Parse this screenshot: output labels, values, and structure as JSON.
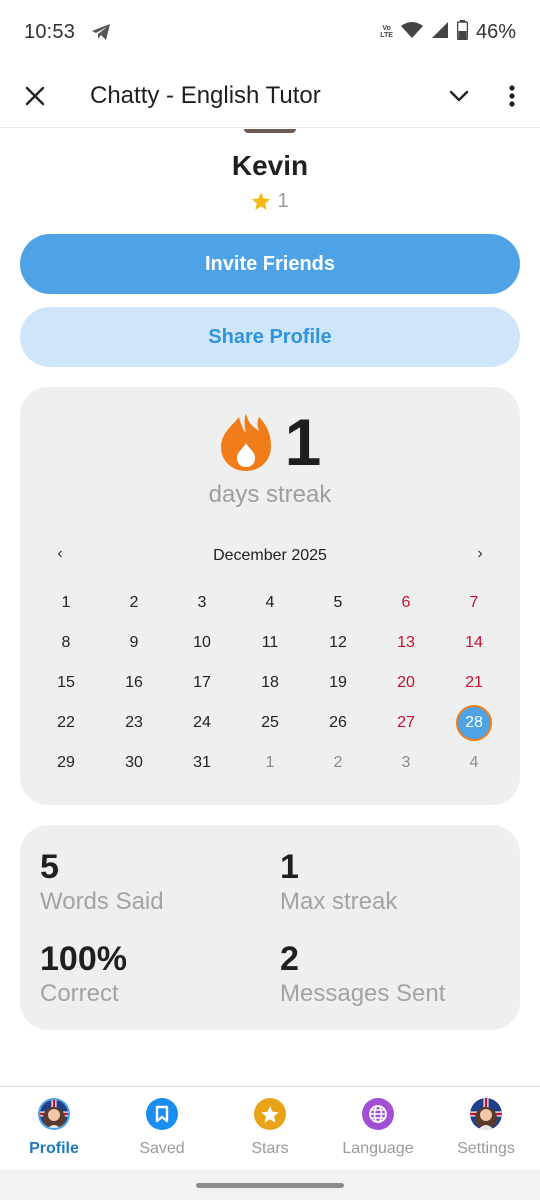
{
  "status_bar": {
    "time": "10:53",
    "volte_line1": "Vo",
    "volte_line2": "LTE",
    "battery": "46%",
    "icons": [
      "telegram-icon",
      "volte-icon",
      "wifi-icon",
      "signal-icon",
      "battery-icon"
    ]
  },
  "app_bar": {
    "title": "Chatty - English Tutor",
    "icons": [
      "close-icon",
      "chevron-down-icon",
      "more-vert-icon"
    ]
  },
  "profile": {
    "name": "Kevin",
    "stars": "1"
  },
  "buttons": {
    "invite": "Invite Friends",
    "share": "Share Profile"
  },
  "streak": {
    "count": "1",
    "label": "days streak",
    "icon": "flame-icon",
    "accent_color": "#f07d1a"
  },
  "calendar": {
    "month": "December 2025",
    "prev": "‹",
    "next": "›",
    "days": [
      {
        "d": "1",
        "type": "normal"
      },
      {
        "d": "2",
        "type": "normal"
      },
      {
        "d": "3",
        "type": "normal"
      },
      {
        "d": "4",
        "type": "normal"
      },
      {
        "d": "5",
        "type": "normal"
      },
      {
        "d": "6",
        "type": "weekend"
      },
      {
        "d": "7",
        "type": "weekend"
      },
      {
        "d": "8",
        "type": "normal"
      },
      {
        "d": "9",
        "type": "normal"
      },
      {
        "d": "10",
        "type": "normal"
      },
      {
        "d": "11",
        "type": "normal"
      },
      {
        "d": "12",
        "type": "normal"
      },
      {
        "d": "13",
        "type": "weekend"
      },
      {
        "d": "14",
        "type": "weekend"
      },
      {
        "d": "15",
        "type": "normal"
      },
      {
        "d": "16",
        "type": "normal"
      },
      {
        "d": "17",
        "type": "normal"
      },
      {
        "d": "18",
        "type": "normal"
      },
      {
        "d": "19",
        "type": "normal"
      },
      {
        "d": "20",
        "type": "weekend"
      },
      {
        "d": "21",
        "type": "weekend"
      },
      {
        "d": "22",
        "type": "normal"
      },
      {
        "d": "23",
        "type": "normal"
      },
      {
        "d": "24",
        "type": "normal"
      },
      {
        "d": "25",
        "type": "normal"
      },
      {
        "d": "26",
        "type": "normal"
      },
      {
        "d": "27",
        "type": "weekend"
      },
      {
        "d": "28",
        "type": "today"
      },
      {
        "d": "29",
        "type": "normal"
      },
      {
        "d": "30",
        "type": "normal"
      },
      {
        "d": "31",
        "type": "normal"
      },
      {
        "d": "1",
        "type": "other"
      },
      {
        "d": "2",
        "type": "other"
      },
      {
        "d": "3",
        "type": "other"
      },
      {
        "d": "4",
        "type": "other"
      }
    ],
    "weekend_color": "#c8102e",
    "today_color": "#4da3e6"
  },
  "stats": {
    "words_said_value": "5",
    "words_said_label": "Words Said",
    "max_streak_value": "1",
    "max_streak_label": "Max streak",
    "correct_value": "100%",
    "correct_label": "Correct",
    "messages_value": "2",
    "messages_label": "Messages Sent"
  },
  "bottom_nav": {
    "items": [
      {
        "label": "Profile",
        "icon": "profile-avatar-icon",
        "active": true
      },
      {
        "label": "Saved",
        "icon": "bookmark-icon",
        "active": false
      },
      {
        "label": "Stars",
        "icon": "star-icon",
        "active": false
      },
      {
        "label": "Language",
        "icon": "globe-icon",
        "active": false
      },
      {
        "label": "Settings",
        "icon": "settings-avatar-icon",
        "active": false
      }
    ]
  },
  "colors": {
    "primary": "#4da3e6",
    "primary_light": "#cfe6fa",
    "card_bg": "#efefef",
    "active_nav": "#1f7ab8"
  }
}
